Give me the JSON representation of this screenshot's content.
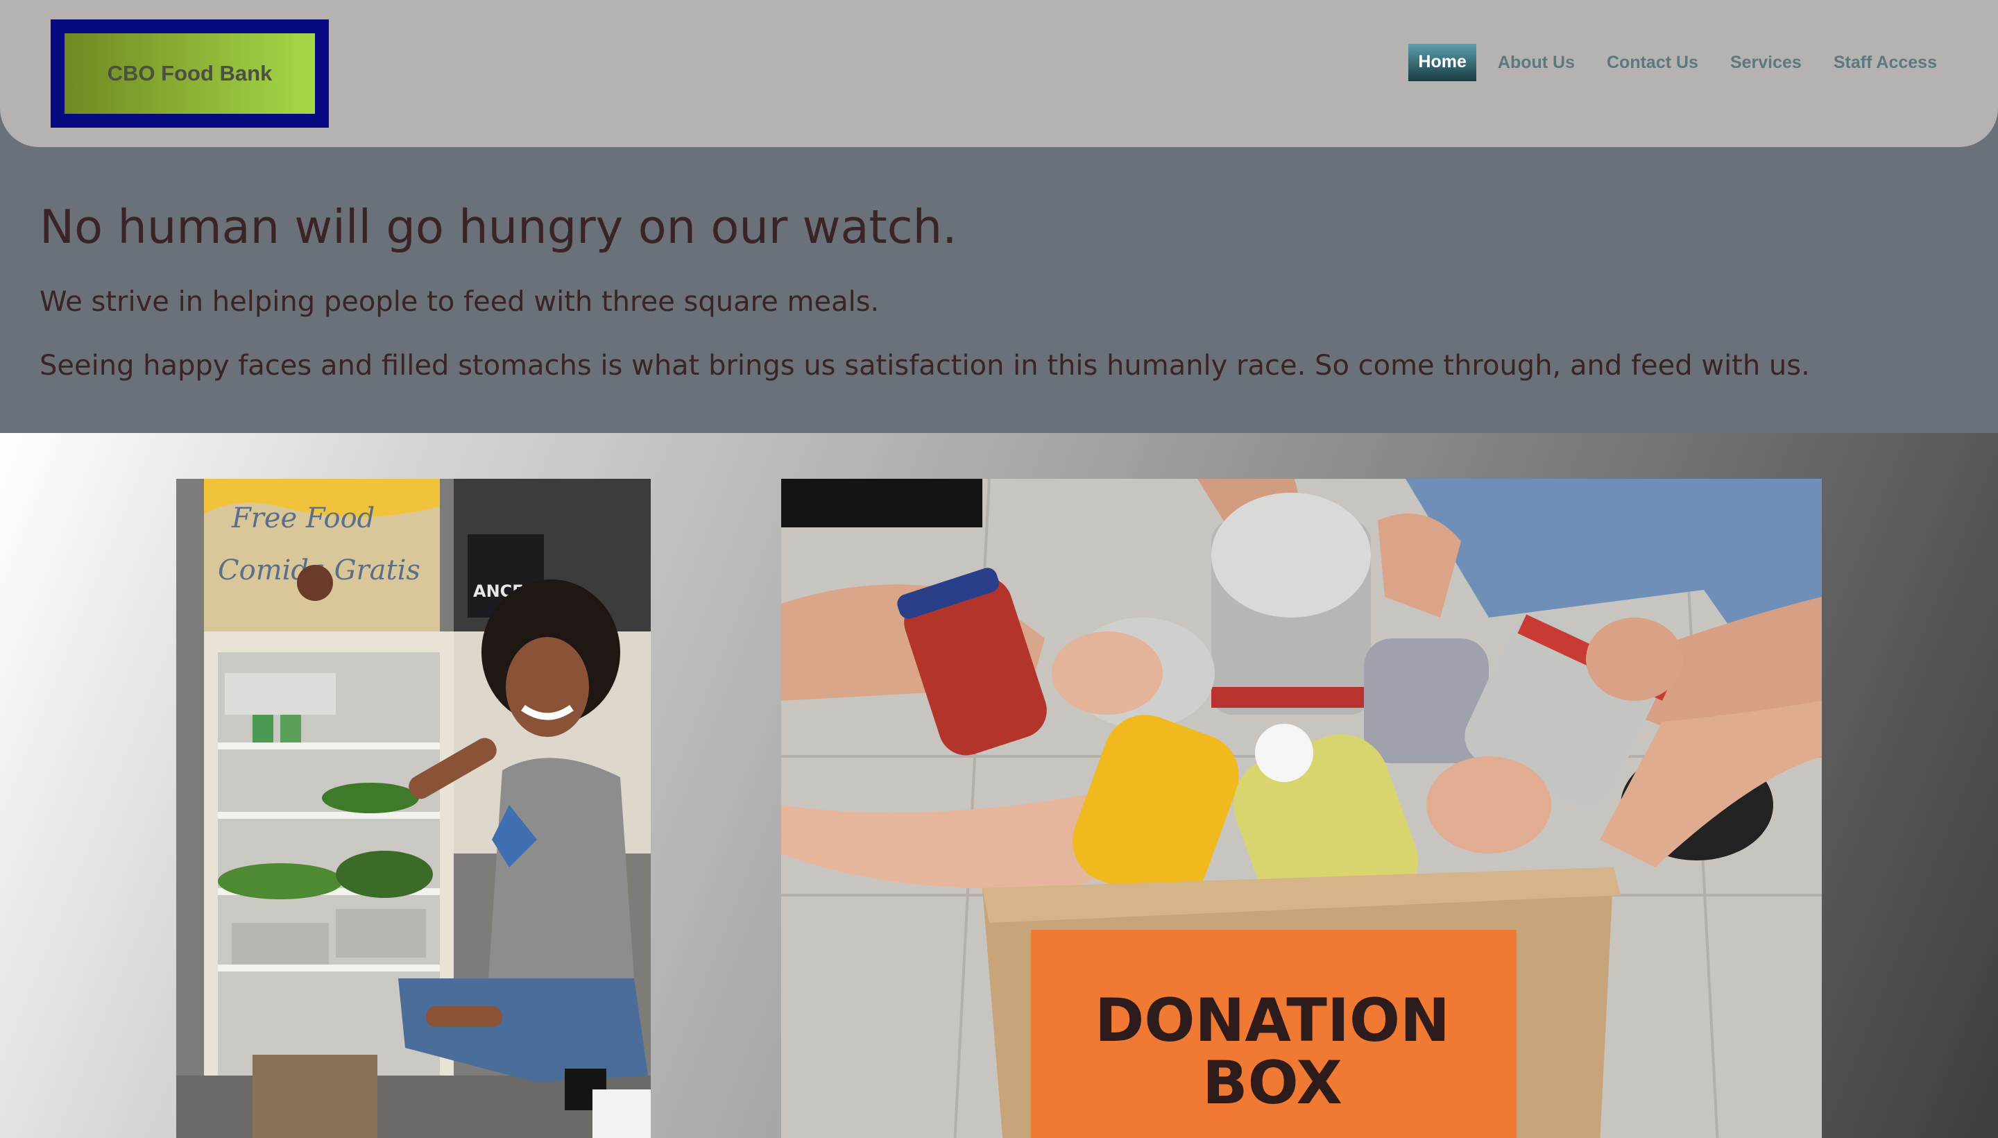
{
  "header": {
    "logo_text": "CBO Food Bank",
    "nav": [
      {
        "label": "Home",
        "active": true
      },
      {
        "label": "About Us",
        "active": false
      },
      {
        "label": "Contact Us",
        "active": false
      },
      {
        "label": "Services",
        "active": false
      },
      {
        "label": "Staff Access",
        "active": false
      }
    ]
  },
  "hero": {
    "headline": "No human will go hungry on our watch.",
    "paragraph_1": "We strive in helping people to feed with three square meals.",
    "paragraph_2": "Seeing happy faces and filled stomachs is what brings us satisfaction in this humanly race. So come through, and feed with us."
  },
  "gallery": {
    "photo_1": {
      "sign_line_1": "Free Food",
      "sign_line_2": "Comida Gratis",
      "banner_text": "ANCE"
    },
    "photo_2": {
      "box_line_1": "DONATION",
      "box_line_2": "BOX"
    }
  },
  "colors": {
    "header_bg": "#b7b2b2",
    "hero_bg": "#6b7178",
    "logo_border": "#080a80",
    "nav_text": "#5a7a7e",
    "hero_text": "#3b2426"
  }
}
